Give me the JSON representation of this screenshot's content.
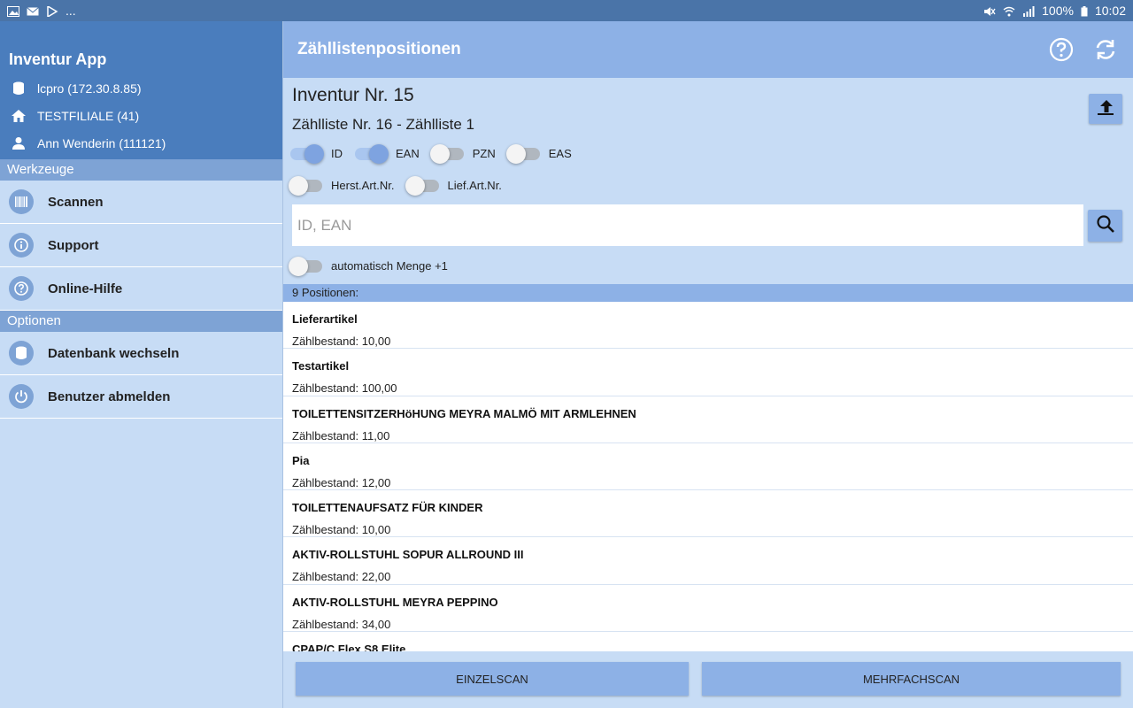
{
  "status_bar": {
    "left_ellipsis": "...",
    "battery": "100%",
    "time": "10:02",
    "icons": [
      "image-icon",
      "mail-icon",
      "play-store-icon",
      "mute-icon",
      "wifi-icon",
      "signal-icon",
      "battery-icon"
    ]
  },
  "drawer": {
    "app_title": "Inventur App",
    "database": "lcpro (172.30.8.85)",
    "branch": "TESTFILIALE (41)",
    "user": "Ann Wenderin (111121)",
    "sections": {
      "tools": "Werkzeuge",
      "options": "Optionen"
    },
    "tools": [
      {
        "label": "Scannen",
        "icon": "barcode-icon"
      },
      {
        "label": "Support",
        "icon": "info-icon"
      },
      {
        "label": "Online-Hilfe",
        "icon": "help-icon"
      }
    ],
    "options": [
      {
        "label": "Datenbank wechseln",
        "icon": "database-icon"
      },
      {
        "label": "Benutzer abmelden",
        "icon": "power-icon"
      }
    ]
  },
  "appbar": {
    "title": "Zähllistenpositionen",
    "actions": [
      "help-icon",
      "refresh-icon"
    ]
  },
  "header": {
    "inventory": "Inventur Nr. 15",
    "count_list": "Zählliste Nr. 16 - Zählliste 1"
  },
  "toggles": {
    "id": {
      "label": "ID",
      "on": true
    },
    "ean": {
      "label": "EAN",
      "on": true
    },
    "pzn": {
      "label": "PZN",
      "on": false
    },
    "eas": {
      "label": "EAS",
      "on": false
    },
    "herst": {
      "label": "Herst.Art.Nr.",
      "on": false
    },
    "lief": {
      "label": "Lief.Art.Nr.",
      "on": false
    },
    "auto_qty": {
      "label": "automatisch Menge +1",
      "on": false
    }
  },
  "search": {
    "placeholder": "ID, EAN",
    "value": ""
  },
  "list": {
    "header": "9 Positionen:",
    "items": [
      {
        "name": "Lieferartikel",
        "qty": "Zählbestand: 10,00"
      },
      {
        "name": "Testartikel",
        "qty": "Zählbestand: 100,00"
      },
      {
        "name": "TOILETTENSITZERHöHUNG MEYRA MALMÖ MIT ARMLEHNEN",
        "qty": "Zählbestand: 11,00"
      },
      {
        "name": "Pia",
        "qty": "Zählbestand: 12,00"
      },
      {
        "name": "TOILETTENAUFSATZ FÜR KINDER",
        "qty": "Zählbestand: 10,00"
      },
      {
        "name": "AKTIV-ROLLSTUHL SOPUR ALLROUND III",
        "qty": "Zählbestand: 22,00"
      },
      {
        "name": "AKTIV-ROLLSTUHL MEYRA PEPPINO",
        "qty": "Zählbestand: 34,00"
      },
      {
        "name": "CPAP/C Flex S8 Elite",
        "qty": ""
      }
    ]
  },
  "buttons": {
    "single": "EINZELSCAN",
    "multi": "MEHRFACHSCAN"
  },
  "colors": {
    "status_bar": "#4a74a8",
    "drawer_header": "#4a7dbd",
    "appbar": "#8db1e6",
    "panel": "#c7dcf5",
    "accent": "#7ea3e0"
  }
}
